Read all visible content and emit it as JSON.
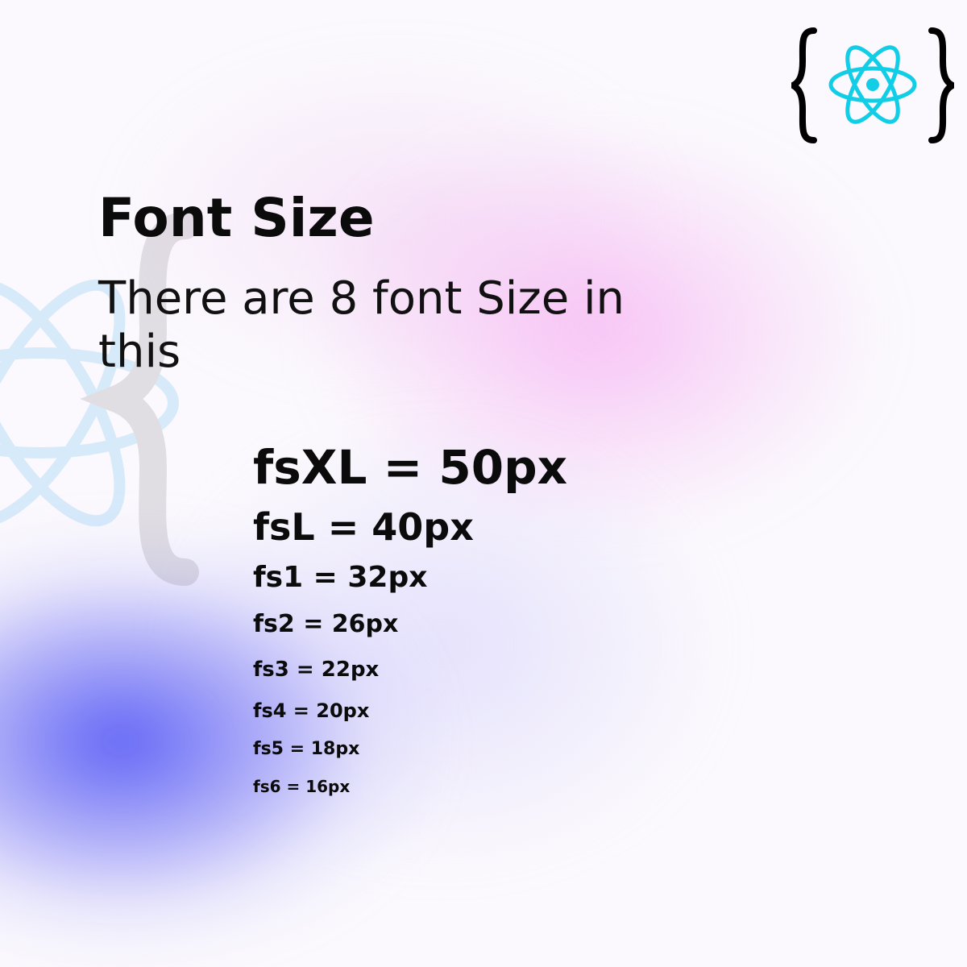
{
  "logo": {
    "icon": "react-braces-logo-icon",
    "brace_color": "#000000",
    "atom_color": "#12cde6"
  },
  "heading": {
    "title": "Font Size",
    "description": "There are 8 font Size in this"
  },
  "font_sizes": [
    {
      "label": "fsXL = 50px"
    },
    {
      "label": "fsL = 40px"
    },
    {
      "label": "fs1 = 32px"
    },
    {
      "label": "fs2 = 26px"
    },
    {
      "label": "fs3 = 22px"
    },
    {
      "label": "fs4 = 20px"
    },
    {
      "label": "fs5 = 18px"
    },
    {
      "label": "fs6 = 16px"
    }
  ],
  "colors": {
    "pink_glow": "#f496ee",
    "blue_glow": "#585cf5",
    "background": "#fbf9fd",
    "text": "#0b0b0b"
  }
}
